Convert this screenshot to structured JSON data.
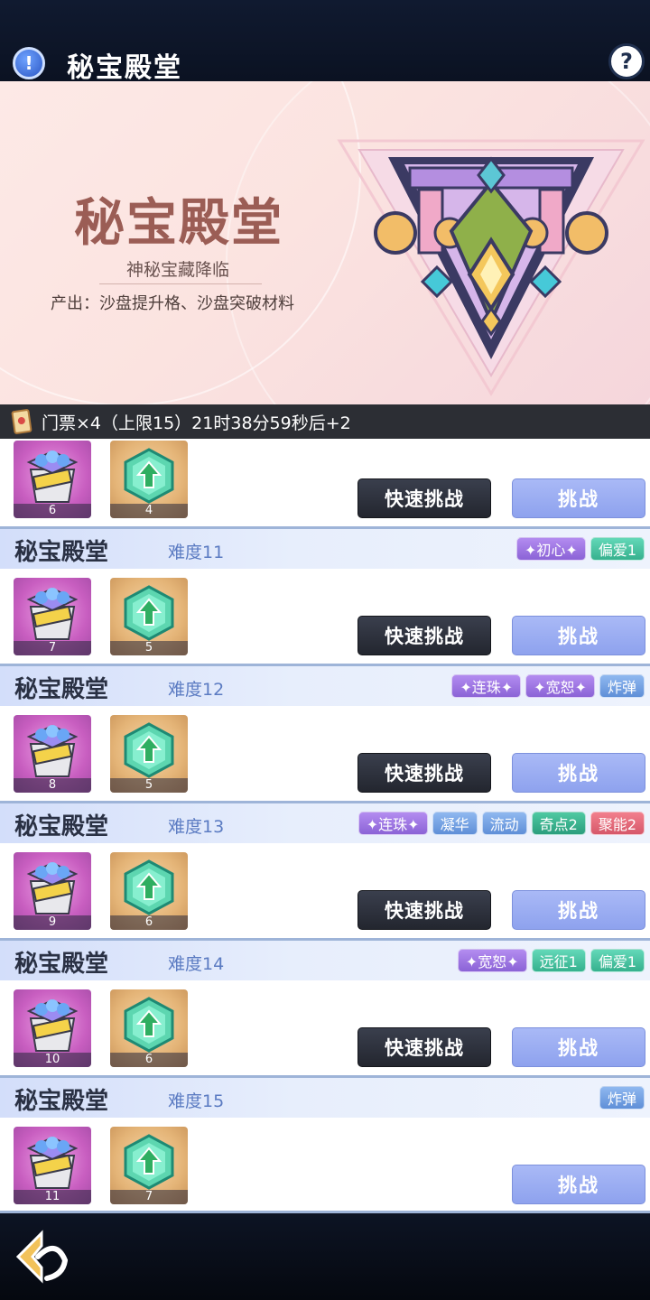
{
  "header": {
    "title": "秘宝殿堂",
    "info_icon": "exclamation-icon",
    "help_icon": "question-icon"
  },
  "banner": {
    "title": "秘宝殿堂",
    "subtitle": "神秘宝藏降临",
    "description": "产出：沙盘提升格、沙盘突破材料"
  },
  "ticket": {
    "text": "门票×4（上限15）21时38分59秒后+2"
  },
  "buttons": {
    "quick": "快速挑战",
    "challenge": "挑战"
  },
  "colors": {
    "accent": "#8ea2ee",
    "dark_button": "#23262f"
  },
  "rows": [
    {
      "name": "",
      "difficulty": "",
      "tags": [],
      "chest_count": "6",
      "gem_count": "4",
      "quick": true
    },
    {
      "name": "秘宝殿堂",
      "difficulty": "难度11",
      "tags": [
        {
          "label": "✦初心✦",
          "style": "purple"
        },
        {
          "label": "偏爱1",
          "style": "green"
        }
      ],
      "chest_count": "7",
      "gem_count": "5",
      "quick": true
    },
    {
      "name": "秘宝殿堂",
      "difficulty": "难度12",
      "tags": [
        {
          "label": "✦连珠✦",
          "style": "purple"
        },
        {
          "label": "✦宽恕✦",
          "style": "purple"
        },
        {
          "label": "炸弹",
          "style": "blue"
        }
      ],
      "chest_count": "8",
      "gem_count": "5",
      "quick": true
    },
    {
      "name": "秘宝殿堂",
      "difficulty": "难度13",
      "tags": [
        {
          "label": "✦连珠✦",
          "style": "purple"
        },
        {
          "label": "凝华",
          "style": "blue"
        },
        {
          "label": "流动",
          "style": "blue"
        },
        {
          "label": "奇点2",
          "style": "teal"
        },
        {
          "label": "聚能2",
          "style": "pink"
        }
      ],
      "chest_count": "9",
      "gem_count": "6",
      "quick": true
    },
    {
      "name": "秘宝殿堂",
      "difficulty": "难度14",
      "tags": [
        {
          "label": "✦宽恕✦",
          "style": "purple"
        },
        {
          "label": "远征1",
          "style": "green"
        },
        {
          "label": "偏爱1",
          "style": "green"
        }
      ],
      "chest_count": "10",
      "gem_count": "6",
      "quick": true
    },
    {
      "name": "秘宝殿堂",
      "difficulty": "难度15",
      "tags": [
        {
          "label": "炸弹",
          "style": "blue"
        }
      ],
      "chest_count": "11",
      "gem_count": "7",
      "quick": false
    }
  ],
  "footer": {
    "back_icon": "back-arrow-icon"
  }
}
